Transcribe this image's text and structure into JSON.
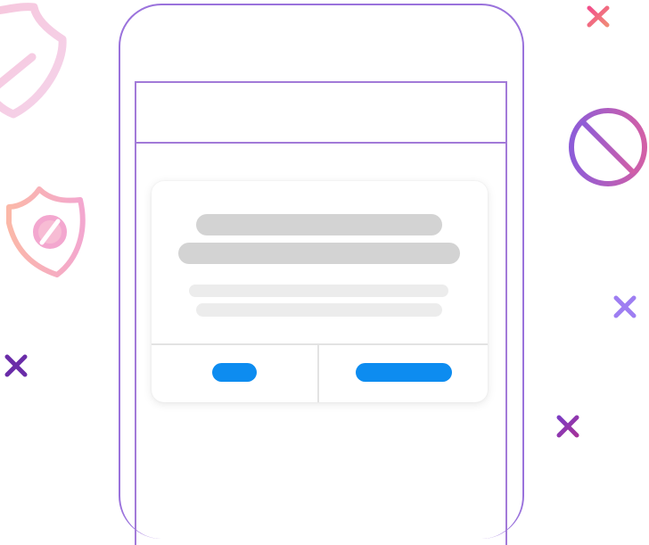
{
  "colors": {
    "phone_frame": "#9a72dc",
    "button": "#0d8cf0",
    "skeleton_dark": "#d3d3d3",
    "skeleton_light": "#ececec"
  },
  "decorations": {
    "icons": [
      "shield-icon",
      "shield-block-icon",
      "block-icon",
      "close-icon"
    ]
  }
}
